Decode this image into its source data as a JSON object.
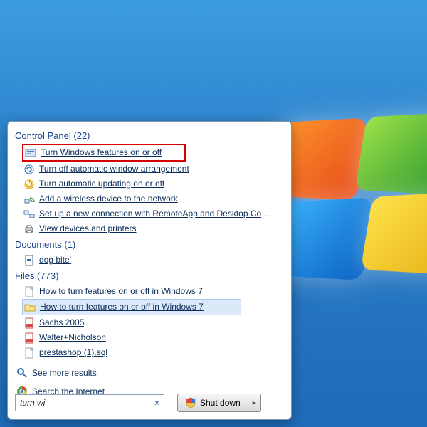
{
  "sections": {
    "control_panel": {
      "title": "Control Panel (22)"
    },
    "documents": {
      "title": "Documents (1)"
    },
    "files": {
      "title": "Files (773)"
    }
  },
  "control_panel_items": [
    "Turn Windows features on or off",
    "Turn off automatic window arrangement",
    "Turn automatic updating on or off",
    "Add a wireless device to the network",
    "Set up a new connection with RemoteApp and Desktop Conne...",
    "View devices and printers"
  ],
  "documents_items": [
    "dog bite'"
  ],
  "files_items": [
    "How to turn features on or off in Windows 7",
    "How to turn features on or off in Windows 7",
    "Sachs 2005",
    "Walter+Nicholson",
    "prestashop (1).sql"
  ],
  "more_results": "See more results",
  "search_internet": "Search the Internet",
  "search_value": "turn wi",
  "shutdown_label": "Shut down"
}
